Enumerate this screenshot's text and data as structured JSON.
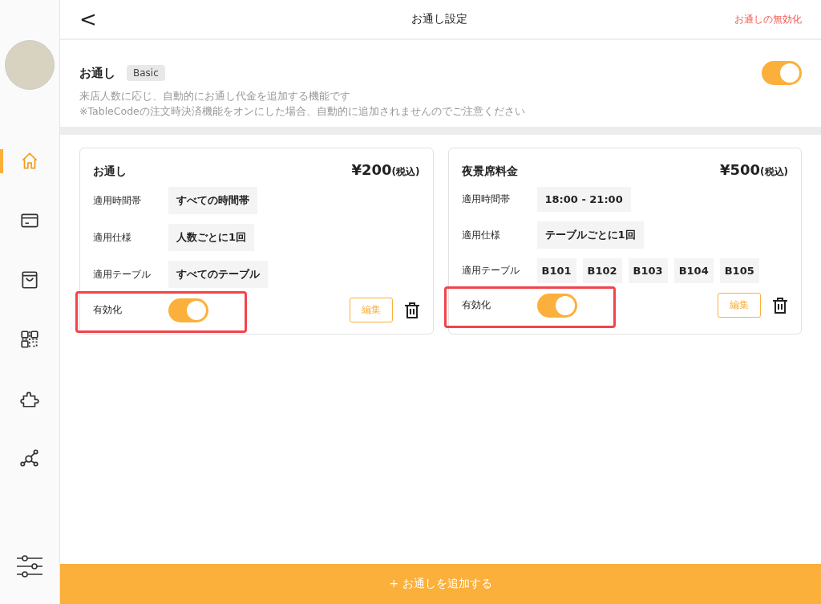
{
  "sidebar": {
    "items": [
      {
        "kind": "home",
        "selected": true
      },
      {
        "kind": "card",
        "selected": false
      },
      {
        "kind": "bag",
        "selected": false
      },
      {
        "kind": "qr",
        "selected": false
      },
      {
        "kind": "puzzle",
        "selected": false
      },
      {
        "kind": "network",
        "selected": false
      }
    ]
  },
  "header": {
    "back": "<",
    "title": "お通し設定",
    "action": "お通しの無効化"
  },
  "intro": {
    "title": "お通し",
    "badge": "Basic",
    "on": true,
    "lines": [
      "来店人数に応じ、自動的にお通し代金を追加する機能です",
      "※TableCodeの注文時決済機能をオンにした場合、自動的に追加されませんのでご注意ください"
    ]
  },
  "cards": [
    {
      "name": "お通し",
      "price": "¥200",
      "tax_note": "(税込)",
      "rows": [
        {
          "label": "適用時間帯",
          "values": [
            "すべての時間帯"
          ]
        },
        {
          "label": "適用仕様",
          "values": [
            "人数ごとに1回"
          ]
        },
        {
          "label": "適用テーブル",
          "values": [
            "すべてのテーブル"
          ]
        }
      ],
      "enable_label": "有効化",
      "enabled": true,
      "highlighted": true,
      "edit": "編集"
    },
    {
      "name": "夜景席料金",
      "price": "¥500",
      "tax_note": "(税込)",
      "rows": [
        {
          "label": "適用時間帯",
          "values": [
            "18:00 - 21:00"
          ]
        },
        {
          "label": "適用仕様",
          "values": [
            "テーブルごとに1回"
          ]
        },
        {
          "label": "適用テーブル",
          "values": [
            "B101",
            "B102",
            "B103",
            "B104",
            "B105"
          ]
        }
      ],
      "enable_label": "有効化",
      "enabled": true,
      "highlighted": true,
      "edit": "編集"
    }
  ],
  "add_button": "+ お通しを追加する"
}
